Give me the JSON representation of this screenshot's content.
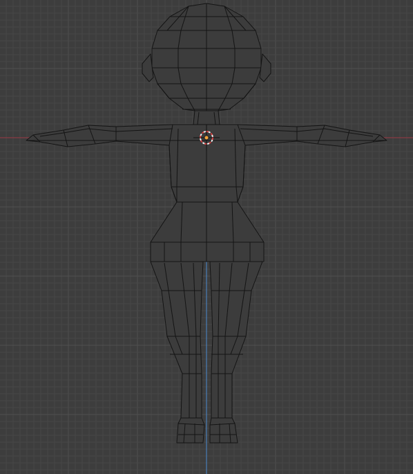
{
  "viewport": {
    "view": "front-orthographic",
    "mode": "wireframe",
    "background": "#3d3d3d",
    "x_axis_color": "#8a3b44",
    "y_axis_color": "#4a7fb8",
    "cursor_color": "#d33c3c"
  },
  "objects": [
    {
      "name": "character-mesh",
      "type": "mesh",
      "display": "wireframe"
    },
    {
      "name": "3d-cursor",
      "type": "cursor",
      "icon": "crosshair-icon"
    },
    {
      "name": "origin-point",
      "type": "origin",
      "color": "#f2a33a"
    }
  ]
}
